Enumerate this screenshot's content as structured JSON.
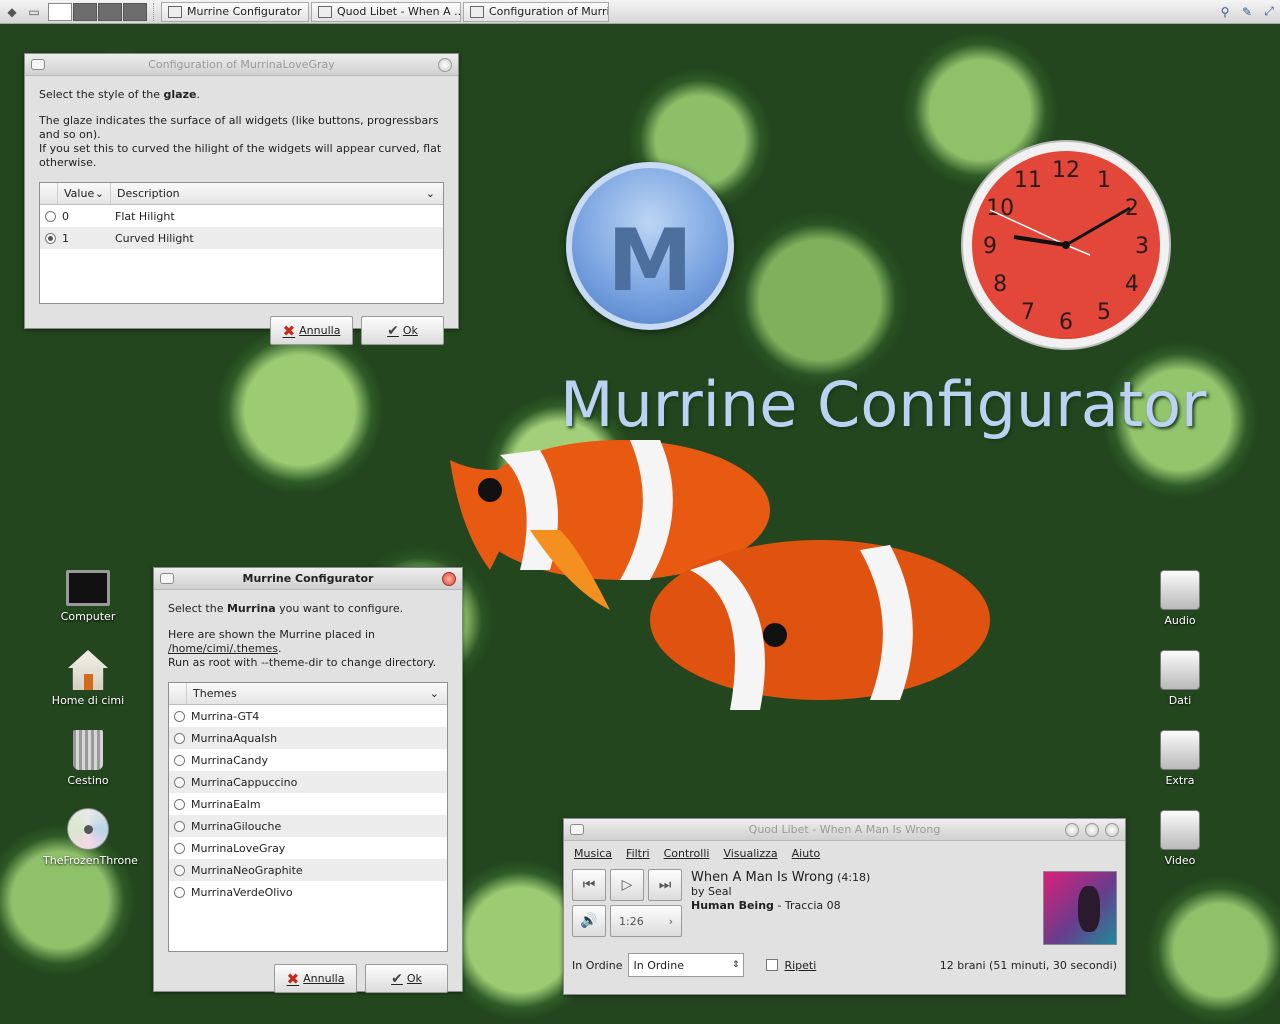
{
  "taskbar": {
    "tasks": [
      "Murrine Configurator",
      "Quod Libet - When A ...",
      "Configuration of Murri..."
    ]
  },
  "glaze_window": {
    "title": "Configuration of MurrinaLoveGray",
    "intro_prefix": "Select the style of the ",
    "intro_bold": "glaze",
    "intro_suffix": ".",
    "desc_line1": "The glaze indicates the surface of all widgets (like buttons, progressbars and so on).",
    "desc_line2": "If you set this to curved the hilight of the widgets will appear curved, flat otherwise.",
    "col_value": "Value",
    "col_description": "Description",
    "rows": [
      {
        "value": "0",
        "description": "Flat Hilight",
        "selected": false
      },
      {
        "value": "1",
        "description": "Curved Hilight",
        "selected": true
      }
    ],
    "cancel_label": "Annulla",
    "ok_label": "Ok"
  },
  "configurator_window": {
    "title": "Murrine Configurator",
    "intro_prefix": "Select the ",
    "intro_bold": "Murrina",
    "intro_suffix": " you want to configure.",
    "path_prefix": "Here are shown the Murrine placed in ",
    "path_link": "/home/cimi/.themes",
    "path_suffix": ".",
    "run_hint": "Run as root with --theme-dir to change directory.",
    "col_themes": "Themes",
    "themes": [
      "Murrina-GT4",
      "MurrinaAquaIsh",
      "MurrinaCandy",
      "MurrinaCappuccino",
      "MurrinaEalm",
      "MurrinaGilouche",
      "MurrinaLoveGray",
      "MurrinaNeoGraphite",
      "MurrinaVerdeOlivo"
    ],
    "cancel_label": "Annulla",
    "ok_label": "Ok"
  },
  "desktop": {
    "left_icons": [
      "Computer",
      "Home di cimi",
      "Cestino",
      "TheFrozenThrone"
    ],
    "right_icons": [
      "Audio",
      "Dati",
      "Extra",
      "Video"
    ],
    "logo_letter": "M",
    "big_title": "Murrine Configurator",
    "clock_numbers": [
      "12",
      "1",
      "2",
      "3",
      "4",
      "5",
      "6",
      "7",
      "8",
      "9",
      "10",
      "11"
    ]
  },
  "player": {
    "title": "Quod Libet - When A Man Is Wrong",
    "menu": [
      "Musica",
      "Filtri",
      "Controlli",
      "Visualizza",
      "Aiuto"
    ],
    "song_title": "When A Man Is Wrong",
    "song_length": "(4:18)",
    "artist": "by Seal",
    "album": "Human Being",
    "track": " - Traccia 08",
    "position": "1:26",
    "order_label": "In Ordine",
    "order_value": "In Ordine",
    "repeat_label": "Ripeti",
    "summary": "12 brani (51 minuti, 30 secondi)"
  },
  "colors": {
    "clock_face": "#e2473a",
    "logo_blue": "#7ba5e1",
    "title_text": "#bcd2f2",
    "cancel_icon": "#c52a1a"
  }
}
